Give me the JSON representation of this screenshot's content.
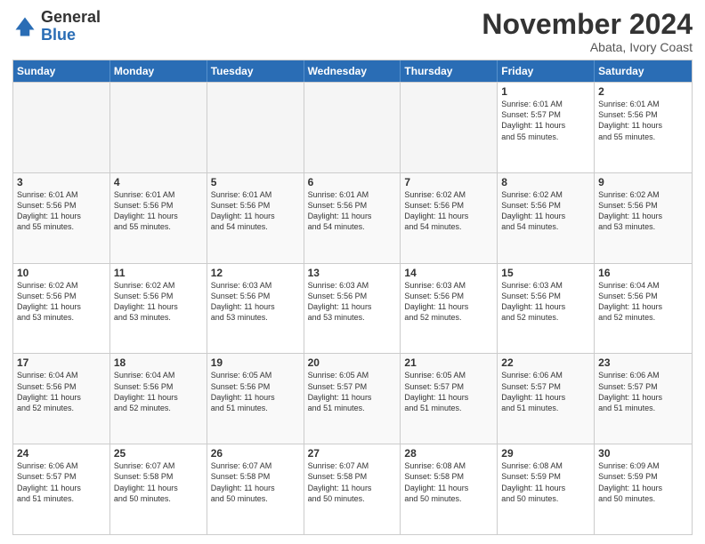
{
  "logo": {
    "general": "General",
    "blue": "Blue"
  },
  "header": {
    "month": "November 2024",
    "location": "Abata, Ivory Coast"
  },
  "weekdays": [
    "Sunday",
    "Monday",
    "Tuesday",
    "Wednesday",
    "Thursday",
    "Friday",
    "Saturday"
  ],
  "rows": [
    [
      {
        "day": "",
        "info": "",
        "empty": true
      },
      {
        "day": "",
        "info": "",
        "empty": true
      },
      {
        "day": "",
        "info": "",
        "empty": true
      },
      {
        "day": "",
        "info": "",
        "empty": true
      },
      {
        "day": "",
        "info": "",
        "empty": true
      },
      {
        "day": "1",
        "info": "Sunrise: 6:01 AM\nSunset: 5:57 PM\nDaylight: 11 hours\nand 55 minutes.",
        "empty": false
      },
      {
        "day": "2",
        "info": "Sunrise: 6:01 AM\nSunset: 5:56 PM\nDaylight: 11 hours\nand 55 minutes.",
        "empty": false
      }
    ],
    [
      {
        "day": "3",
        "info": "Sunrise: 6:01 AM\nSunset: 5:56 PM\nDaylight: 11 hours\nand 55 minutes.",
        "empty": false
      },
      {
        "day": "4",
        "info": "Sunrise: 6:01 AM\nSunset: 5:56 PM\nDaylight: 11 hours\nand 55 minutes.",
        "empty": false
      },
      {
        "day": "5",
        "info": "Sunrise: 6:01 AM\nSunset: 5:56 PM\nDaylight: 11 hours\nand 54 minutes.",
        "empty": false
      },
      {
        "day": "6",
        "info": "Sunrise: 6:01 AM\nSunset: 5:56 PM\nDaylight: 11 hours\nand 54 minutes.",
        "empty": false
      },
      {
        "day": "7",
        "info": "Sunrise: 6:02 AM\nSunset: 5:56 PM\nDaylight: 11 hours\nand 54 minutes.",
        "empty": false
      },
      {
        "day": "8",
        "info": "Sunrise: 6:02 AM\nSunset: 5:56 PM\nDaylight: 11 hours\nand 54 minutes.",
        "empty": false
      },
      {
        "day": "9",
        "info": "Sunrise: 6:02 AM\nSunset: 5:56 PM\nDaylight: 11 hours\nand 53 minutes.",
        "empty": false
      }
    ],
    [
      {
        "day": "10",
        "info": "Sunrise: 6:02 AM\nSunset: 5:56 PM\nDaylight: 11 hours\nand 53 minutes.",
        "empty": false
      },
      {
        "day": "11",
        "info": "Sunrise: 6:02 AM\nSunset: 5:56 PM\nDaylight: 11 hours\nand 53 minutes.",
        "empty": false
      },
      {
        "day": "12",
        "info": "Sunrise: 6:03 AM\nSunset: 5:56 PM\nDaylight: 11 hours\nand 53 minutes.",
        "empty": false
      },
      {
        "day": "13",
        "info": "Sunrise: 6:03 AM\nSunset: 5:56 PM\nDaylight: 11 hours\nand 53 minutes.",
        "empty": false
      },
      {
        "day": "14",
        "info": "Sunrise: 6:03 AM\nSunset: 5:56 PM\nDaylight: 11 hours\nand 52 minutes.",
        "empty": false
      },
      {
        "day": "15",
        "info": "Sunrise: 6:03 AM\nSunset: 5:56 PM\nDaylight: 11 hours\nand 52 minutes.",
        "empty": false
      },
      {
        "day": "16",
        "info": "Sunrise: 6:04 AM\nSunset: 5:56 PM\nDaylight: 11 hours\nand 52 minutes.",
        "empty": false
      }
    ],
    [
      {
        "day": "17",
        "info": "Sunrise: 6:04 AM\nSunset: 5:56 PM\nDaylight: 11 hours\nand 52 minutes.",
        "empty": false
      },
      {
        "day": "18",
        "info": "Sunrise: 6:04 AM\nSunset: 5:56 PM\nDaylight: 11 hours\nand 52 minutes.",
        "empty": false
      },
      {
        "day": "19",
        "info": "Sunrise: 6:05 AM\nSunset: 5:56 PM\nDaylight: 11 hours\nand 51 minutes.",
        "empty": false
      },
      {
        "day": "20",
        "info": "Sunrise: 6:05 AM\nSunset: 5:57 PM\nDaylight: 11 hours\nand 51 minutes.",
        "empty": false
      },
      {
        "day": "21",
        "info": "Sunrise: 6:05 AM\nSunset: 5:57 PM\nDaylight: 11 hours\nand 51 minutes.",
        "empty": false
      },
      {
        "day": "22",
        "info": "Sunrise: 6:06 AM\nSunset: 5:57 PM\nDaylight: 11 hours\nand 51 minutes.",
        "empty": false
      },
      {
        "day": "23",
        "info": "Sunrise: 6:06 AM\nSunset: 5:57 PM\nDaylight: 11 hours\nand 51 minutes.",
        "empty": false
      }
    ],
    [
      {
        "day": "24",
        "info": "Sunrise: 6:06 AM\nSunset: 5:57 PM\nDaylight: 11 hours\nand 51 minutes.",
        "empty": false
      },
      {
        "day": "25",
        "info": "Sunrise: 6:07 AM\nSunset: 5:58 PM\nDaylight: 11 hours\nand 50 minutes.",
        "empty": false
      },
      {
        "day": "26",
        "info": "Sunrise: 6:07 AM\nSunset: 5:58 PM\nDaylight: 11 hours\nand 50 minutes.",
        "empty": false
      },
      {
        "day": "27",
        "info": "Sunrise: 6:07 AM\nSunset: 5:58 PM\nDaylight: 11 hours\nand 50 minutes.",
        "empty": false
      },
      {
        "day": "28",
        "info": "Sunrise: 6:08 AM\nSunset: 5:58 PM\nDaylight: 11 hours\nand 50 minutes.",
        "empty": false
      },
      {
        "day": "29",
        "info": "Sunrise: 6:08 AM\nSunset: 5:59 PM\nDaylight: 11 hours\nand 50 minutes.",
        "empty": false
      },
      {
        "day": "30",
        "info": "Sunrise: 6:09 AM\nSunset: 5:59 PM\nDaylight: 11 hours\nand 50 minutes.",
        "empty": false
      }
    ]
  ]
}
